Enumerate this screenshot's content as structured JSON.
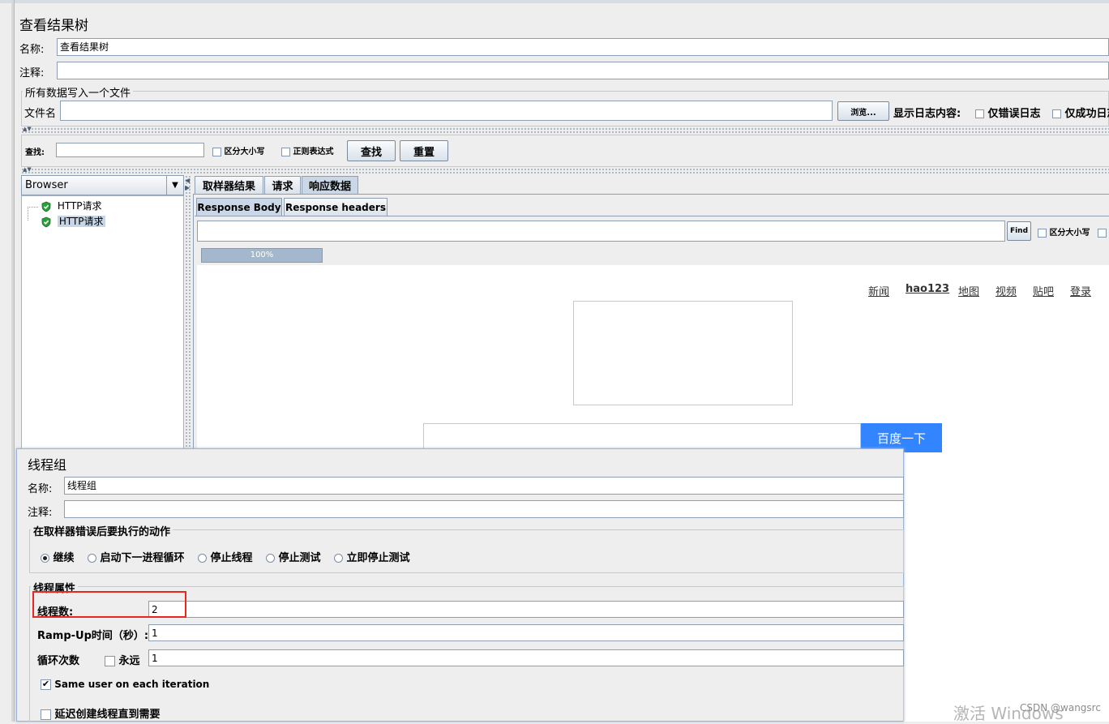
{
  "results": {
    "title": "查看结果树",
    "name_label": "名称:",
    "name_value": "查看结果树",
    "comment_label": "注释:",
    "file_group_title": "所有数据写入一个文件",
    "filename_label": "文件名",
    "browse_button": "浏览...",
    "log_display_label": "显示日志内容:",
    "errors_only": "仅错误日志",
    "success_only": "仅成功日志",
    "search_label": "查找:",
    "case_sensitive": "区分大小写",
    "regex": "正则表达式",
    "find_button": "查找",
    "reset_button": "重置",
    "renderer": "Browser",
    "tree_items": [
      "HTTP请求",
      "HTTP请求"
    ],
    "tabs": [
      "取样器结果",
      "请求",
      "响应数据"
    ],
    "subtabs": [
      "Response Body",
      "Response headers"
    ],
    "find_small": "Find",
    "case_small": "区分大小写",
    "progress_text": "100%",
    "progress_value": 1.0
  },
  "baidu": {
    "links": [
      "新闻",
      "hao123",
      "地图",
      "视频",
      "贴吧",
      "登录"
    ],
    "search_button": "百度一下"
  },
  "thread_group": {
    "title": "线程组",
    "name_label": "名称:",
    "name_value": "线程组",
    "comment_label": "注释:",
    "error_action_title": "在取样器错误后要执行的动作",
    "actions": [
      "继续",
      "启动下一进程循环",
      "停止线程",
      "停止测试",
      "立即停止测试"
    ],
    "selected_action": "继续",
    "props_title": "线程属性",
    "threads_label": "线程数:",
    "threads_value": "2",
    "rampup_label": "Ramp-Up时间（秒）:",
    "rampup_value": "1",
    "loop_label": "循环次数",
    "forever_label": "永远",
    "loop_value": "1",
    "same_user_label": "Same user on each iteration",
    "delay_label": "延迟创建线程直到需要"
  },
  "watermark": {
    "activate": "激活 Windows",
    "csdn": "CSDN @wangsrc"
  }
}
